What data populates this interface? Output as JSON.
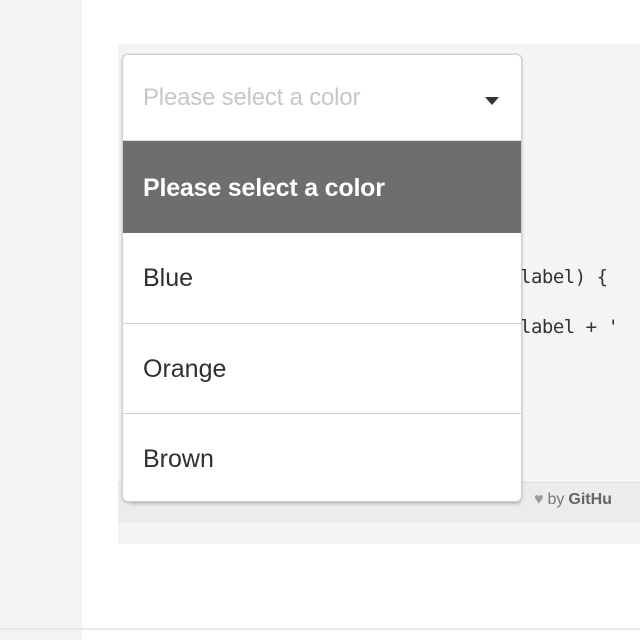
{
  "code": {
    "line_1": "label) {",
    "line_2": "label + '"
  },
  "footer": {
    "credit_by": "by",
    "credit_site": "GitHu"
  },
  "dropdown": {
    "placeholder": "Please select a color",
    "options": [
      {
        "label": "Please select a color",
        "selected": true
      },
      {
        "label": "Blue",
        "selected": false
      },
      {
        "label": "Orange",
        "selected": false
      },
      {
        "label": "Brown",
        "selected": false
      }
    ]
  },
  "icons": {
    "dropdown_arrow": "chevron-down-icon",
    "heart": "heart-icon"
  },
  "colors": {
    "selected_option_background": "#6e6e6e",
    "selected_option_text": "#ffffff",
    "placeholder_text": "#c7c7c7",
    "border": "#cfcfcf"
  }
}
